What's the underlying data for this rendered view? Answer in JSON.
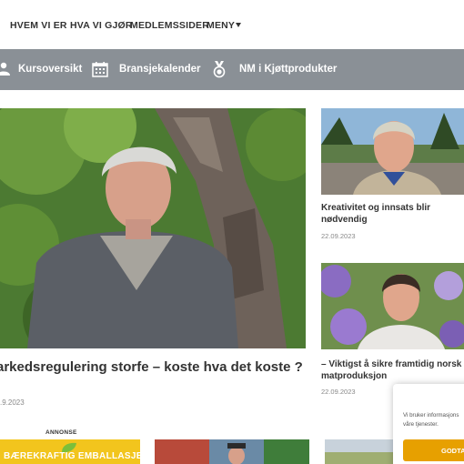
{
  "nav": {
    "items": [
      "HVEM VI ER",
      "HVA VI GJØR",
      "MEDLEMSSIDER",
      "MENY"
    ]
  },
  "toolbar": {
    "items": [
      {
        "label": "Kursoversikt",
        "icon": "course-icon"
      },
      {
        "label": "Bransjekalender",
        "icon": "calendar-icon"
      },
      {
        "label": "NM i Kjøttprodukter",
        "icon": "medal-icon"
      }
    ]
  },
  "hero": {
    "title": "arkedsregulering storfe – koste hva det koste ?",
    "date": ".9.2023"
  },
  "side_articles": [
    {
      "title": "Kreativitet og innsats blir nødvendig",
      "date": "22.09.2023"
    },
    {
      "title": "– Viktigst å sikre framtidig norsk matproduksjon",
      "date": "22.09.2023"
    }
  ],
  "ad": {
    "label": "ANNONSE",
    "text": "BÆREKRAFTIG EMBALLASJE"
  },
  "cookie": {
    "text": "Vi bruker informasjons våre tjenester.",
    "button": "GODTA"
  },
  "colors": {
    "toolbar": "#8a9096",
    "cookie_button": "#e7a000",
    "ad_background": "#f2c51d"
  }
}
